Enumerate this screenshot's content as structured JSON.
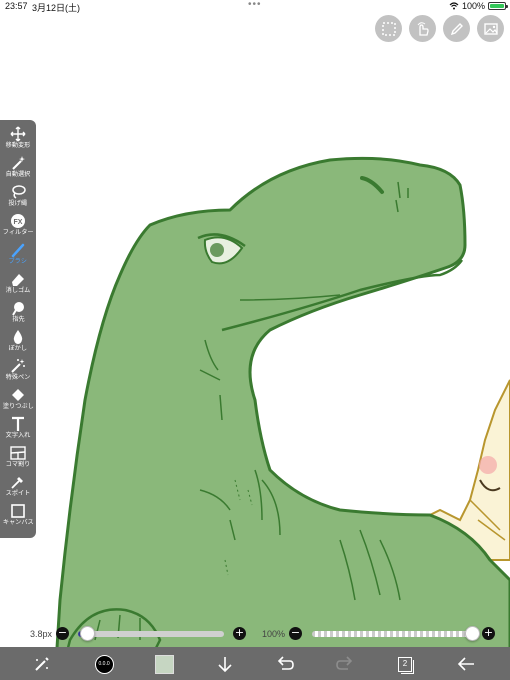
{
  "status_bar": {
    "time": "23:57",
    "date": "3月12日(土)",
    "dots": "•••",
    "battery_text": "100%",
    "battery_level": 1.0
  },
  "top_tools": [
    {
      "name": "selection-icon"
    },
    {
      "name": "hand-gesture-icon"
    },
    {
      "name": "pen-icon"
    },
    {
      "name": "image-icon"
    }
  ],
  "toolbar": {
    "tools": [
      {
        "label": "移動変形",
        "icon": "move-transform-icon",
        "active": false
      },
      {
        "label": "自動選択",
        "icon": "magic-wand-icon",
        "active": false
      },
      {
        "label": "投げ縄",
        "icon": "lasso-icon",
        "active": false
      },
      {
        "label": "フィルター",
        "icon": "fx-icon",
        "active": false
      },
      {
        "label": "ブラシ",
        "icon": "brush-icon",
        "active": true
      },
      {
        "label": "消しゴム",
        "icon": "eraser-icon",
        "active": false
      },
      {
        "label": "指先",
        "icon": "smudge-finger-icon",
        "active": false
      },
      {
        "label": "ぼかし",
        "icon": "blur-drop-icon",
        "active": false
      },
      {
        "label": "特殊ペン",
        "icon": "special-pen-icon",
        "active": false
      },
      {
        "label": "塗りつぶし",
        "icon": "fill-bucket-icon",
        "active": false
      },
      {
        "label": "文字入れ",
        "icon": "text-icon",
        "active": false
      },
      {
        "label": "コマ割り",
        "icon": "panel-divide-icon",
        "active": false
      },
      {
        "label": "スポイト",
        "icon": "eyedropper-icon",
        "active": false
      },
      {
        "label": "キャンバス",
        "icon": "canvas-icon",
        "active": false
      }
    ]
  },
  "sliders": {
    "brush_size": {
      "value_text": "3.8px",
      "level": 0.06
    },
    "opacity": {
      "value_text": "100%",
      "level": 1.0
    }
  },
  "bottom_bar": {
    "main_color": "#000000",
    "main_color_label": "0.0.0",
    "sub_color": "#c6d6c2",
    "layer_count": "2"
  },
  "colors": {
    "toolbar_bg": "#6b6b6b",
    "active_accent": "#4aa3ff",
    "dino_fill": "#8ab87a",
    "dino_outline": "#3a7a30"
  }
}
